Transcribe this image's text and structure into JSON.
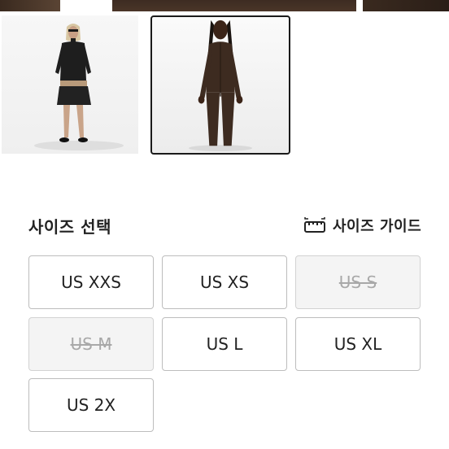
{
  "gallery": {
    "thumbnails": [
      {
        "name": "thumbnail-full-outfit",
        "selected": false
      },
      {
        "name": "thumbnail-front-view",
        "selected": true
      }
    ]
  },
  "size_section": {
    "title": "사이즈 선택",
    "guide_label": "사이즈 가이드",
    "guide_icon": "ruler-icon",
    "options": [
      {
        "label": "US XXS",
        "available": true
      },
      {
        "label": "US XS",
        "available": true
      },
      {
        "label": "US S",
        "available": false
      },
      {
        "label": "US M",
        "available": false
      },
      {
        "label": "US L",
        "available": true
      },
      {
        "label": "US XL",
        "available": true
      },
      {
        "label": "US 2X",
        "available": true
      }
    ]
  },
  "colors": {
    "border": "#bdbdbd",
    "disabled_bg": "#f4f4f4",
    "disabled_text": "#a8a8a8",
    "text": "#222222",
    "garment": "#3d2b20"
  }
}
